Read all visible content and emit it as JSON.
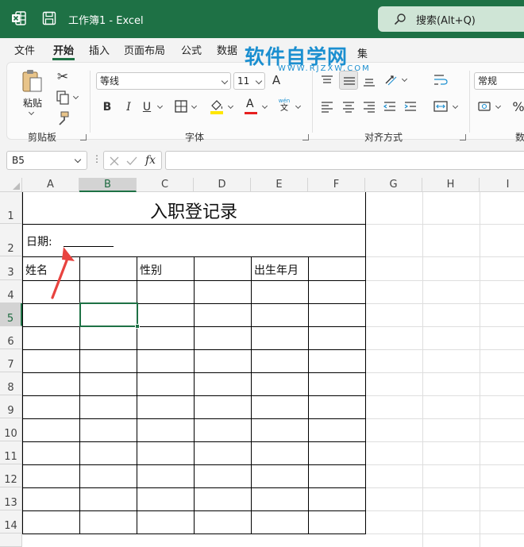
{
  "titlebar": {
    "title": "工作簿1  -  Excel",
    "search_placeholder": "搜索(Alt+Q)",
    "color": "#1e7145"
  },
  "menu": {
    "tabs": [
      "文件",
      "开始",
      "插入",
      "页面布局",
      "公式",
      "数据"
    ],
    "active": "开始",
    "tail": "集"
  },
  "watermark": {
    "main": "软件自学网",
    "sub": "WWW.RJZXW.COM"
  },
  "ribbon": {
    "clipboard": {
      "paste": "粘贴",
      "label": "剪贴板"
    },
    "font": {
      "name": "等线",
      "size": "11",
      "grow": "A",
      "shrink": "A",
      "bold": "B",
      "italic": "I",
      "underline": "U",
      "color_letter": "A",
      "phonetic_top": "wén",
      "phonetic_bottom": "文",
      "label": "字体"
    },
    "alignment": {
      "label": "对齐方式"
    },
    "number": {
      "format": "常规",
      "percent": "%",
      "label": "数"
    }
  },
  "formula_bar": {
    "name_box": "B5",
    "dots": "⋮",
    "fx": "fx",
    "content": ""
  },
  "sheet": {
    "columns": [
      "A",
      "B",
      "C",
      "D",
      "E",
      "F",
      "G",
      "H",
      "I"
    ],
    "selected_column": "B",
    "rows": [
      "1",
      "2",
      "3",
      "4",
      "5",
      "6",
      "7",
      "8",
      "9",
      "10",
      "11",
      "12",
      "13",
      "14"
    ],
    "selected_row": "5",
    "title": "入职登记录",
    "date_label": "日期:",
    "name_label": "姓名",
    "gender_label": "性别",
    "birth_label": "出生年月",
    "selected_cell": "B5"
  },
  "colors": {
    "accent": "#1e7145",
    "arrow": "#e8433f",
    "watermark": "#1b8fd0"
  }
}
